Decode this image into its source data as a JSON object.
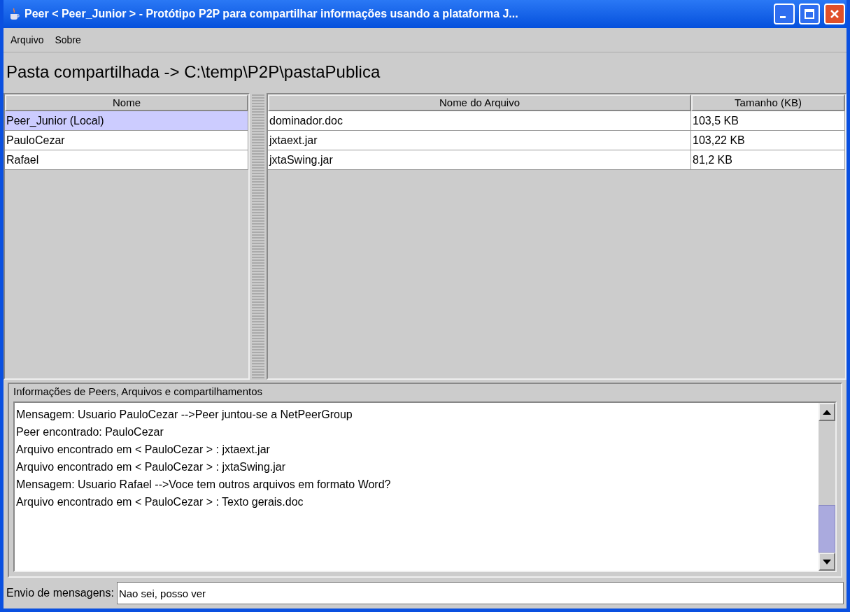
{
  "window": {
    "title": "Peer < Peer_Junior > - Protótipo P2P para compartilhar informações  usando a plataforma J..."
  },
  "menu": [
    "Arquivo",
    "Sobre"
  ],
  "heading": "Pasta compartilhada -> C:\\temp\\P2P\\pastaPublica",
  "peers": {
    "columns": [
      "Nome"
    ],
    "rows": [
      {
        "name": "Peer_Junior (Local)",
        "selected": true
      },
      {
        "name": "PauloCezar",
        "selected": false
      },
      {
        "name": "Rafael",
        "selected": false
      }
    ]
  },
  "files": {
    "columns": [
      "Nome do Arquivo",
      "Tamanho (KB)"
    ],
    "rows": [
      [
        "dominador.doc",
        "103,5 KB"
      ],
      [
        "jxtaext.jar",
        "103,22 KB"
      ],
      [
        "jxtaSwing.jar",
        "81,2 KB"
      ]
    ]
  },
  "log": {
    "title": "Informações de Peers, Arquivos e compartilhamentos",
    "lines": [
      "Mensagem: Usuario PauloCezar  -->Peer juntou-se a NetPeerGroup",
      "Peer encontrado: PauloCezar",
      "Arquivo encontrado em < PauloCezar > : jxtaext.jar",
      "Arquivo encontrado em < PauloCezar > : jxtaSwing.jar",
      "Mensagem: Usuario Rafael  -->Voce tem outros arquivos em formato Word?",
      "Arquivo encontrado em < PauloCezar > : Texto gerais.doc"
    ]
  },
  "message": {
    "label": "Envio de mensagens:",
    "value": "Nao sei, posso ver"
  }
}
